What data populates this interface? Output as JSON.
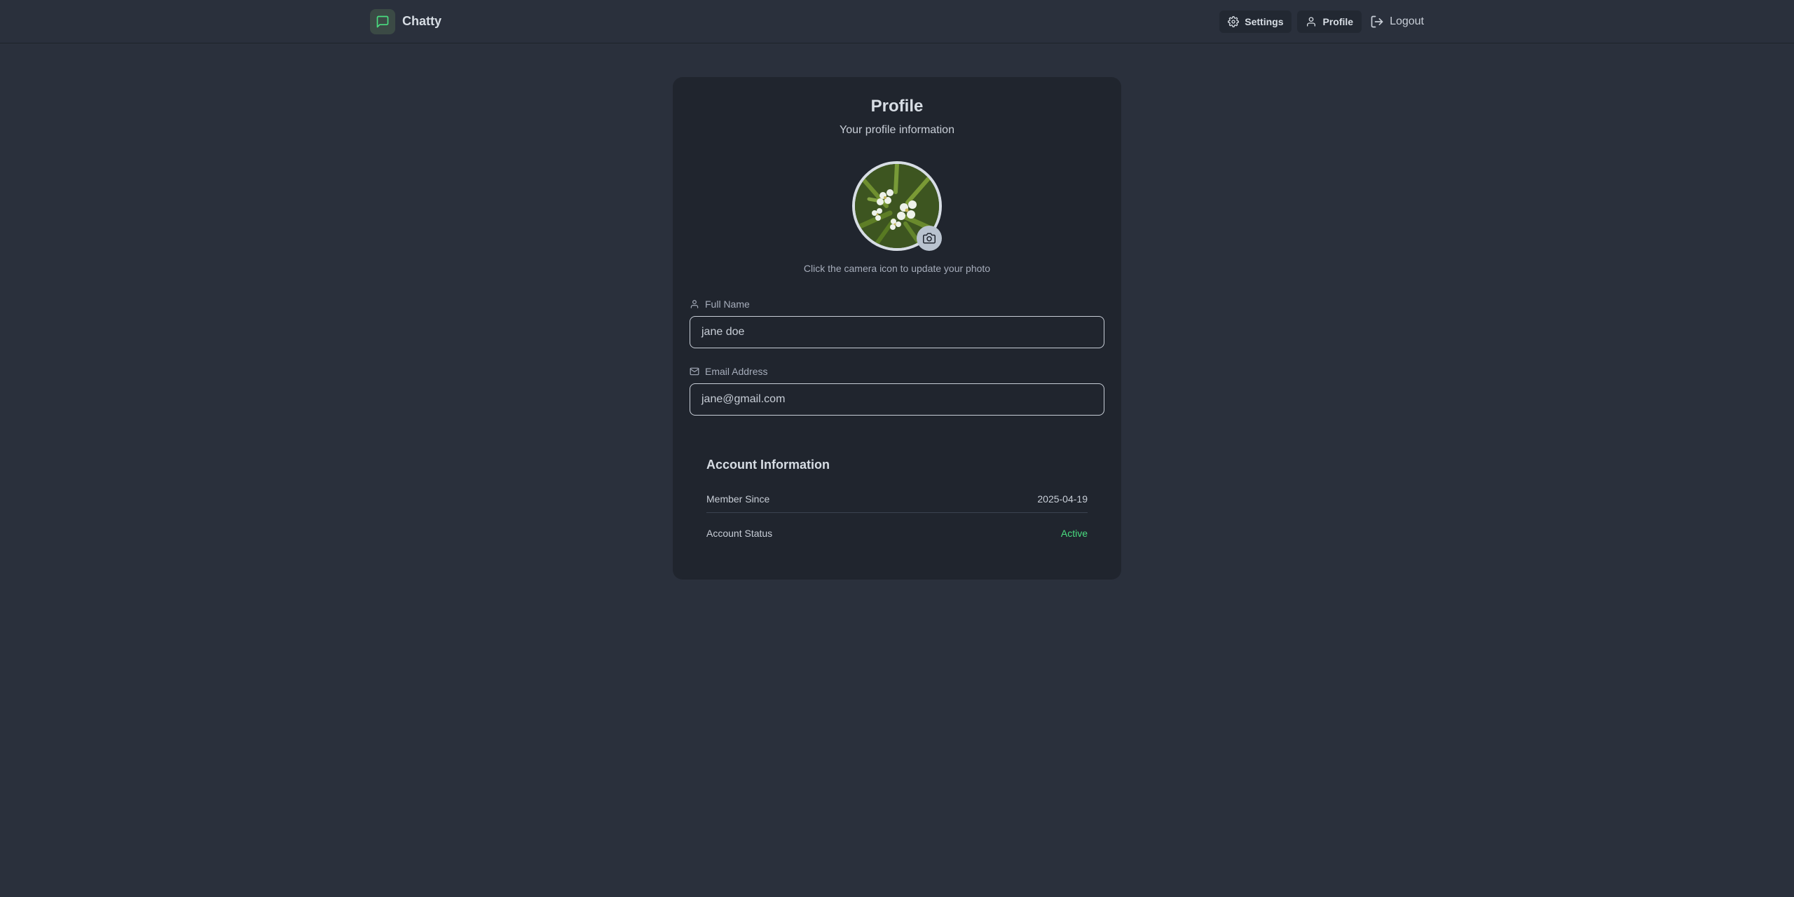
{
  "app": {
    "name": "Chatty",
    "accent": "#4ade80"
  },
  "nav": {
    "settings_label": "Settings",
    "profile_label": "Profile",
    "logout_label": "Logout"
  },
  "profile": {
    "title": "Profile",
    "subtitle": "Your profile information",
    "photo_hint": "Click the camera icon to update your photo",
    "full_name_label": "Full Name",
    "full_name_value": "jane doe",
    "email_label": "Email Address",
    "email_value": "jane@gmail.com"
  },
  "account": {
    "title": "Account Information",
    "rows": [
      {
        "label": "Member Since",
        "value": "2025-04-19"
      },
      {
        "label": "Account Status",
        "value": "Active",
        "value_color": "#4ade80"
      }
    ]
  },
  "icons": {
    "logo": "message-square-icon",
    "settings": "gear-icon",
    "profile": "user-icon",
    "logout": "logout-icon",
    "camera": "camera-icon",
    "full_name": "user-icon",
    "email": "mail-icon"
  }
}
